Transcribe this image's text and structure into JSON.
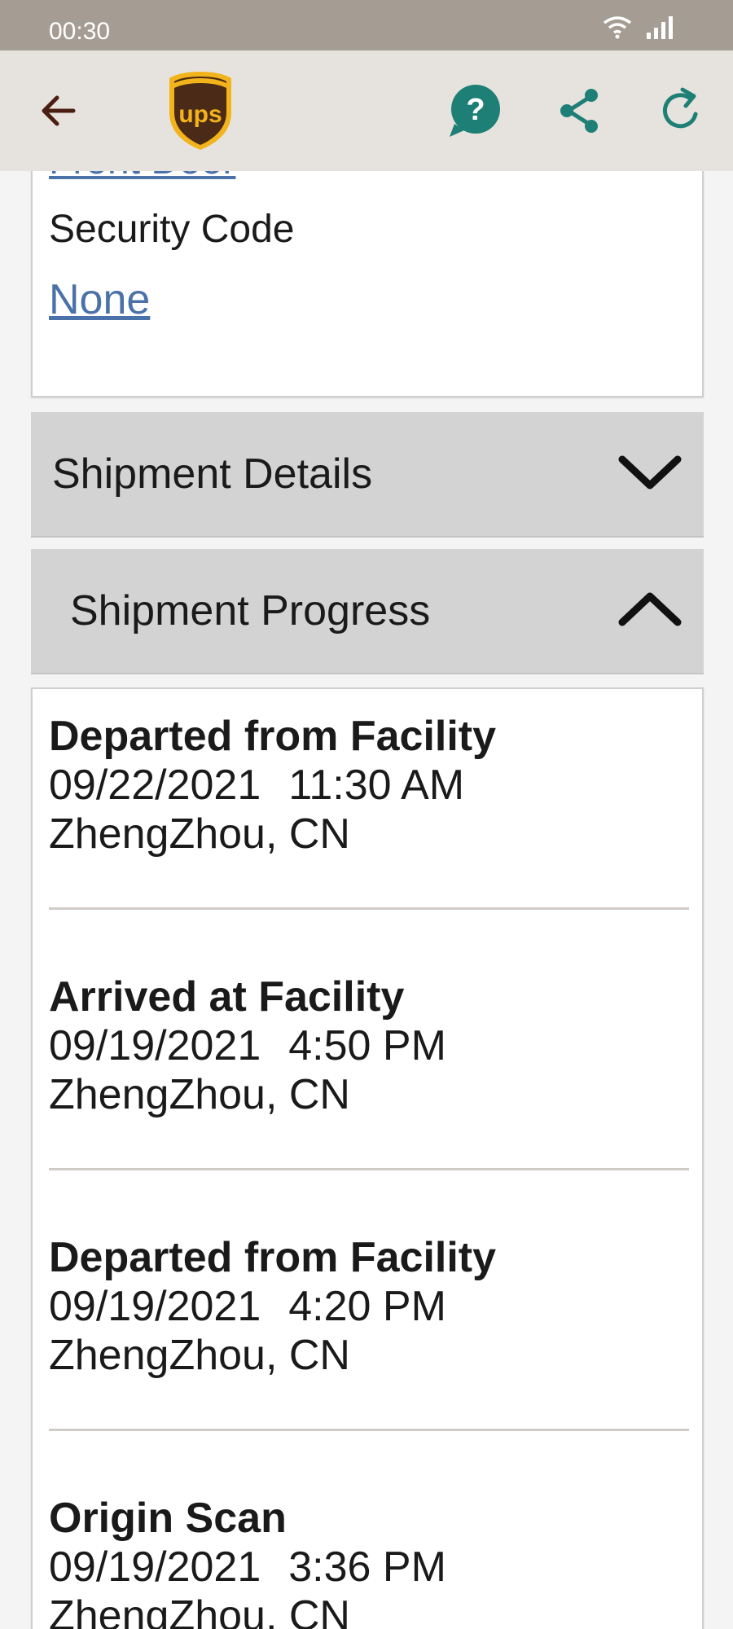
{
  "status_bar": {
    "time": "00:30",
    "icons": [
      "wifi-icon",
      "signal-icon"
    ]
  },
  "app_bar": {
    "icons": [
      "arrow-left-icon",
      "ups-logo",
      "help-chat-icon",
      "share-icon",
      "refresh-icon"
    ],
    "colors": {
      "background": "#e6e3de",
      "back": "#4a1f12",
      "accent": "#1d7f76"
    }
  },
  "delivery_card": {
    "cut_link": "Front Door",
    "security_label": "Security Code",
    "security_value": "None"
  },
  "sections": {
    "details": {
      "title": "Shipment Details",
      "state": "collapsed"
    },
    "progress": {
      "title": "Shipment Progress",
      "state": "expanded"
    }
  },
  "progress": [
    {
      "status": "Departed from Facility",
      "date": "09/22/2021",
      "time": "11:30 AM",
      "location": "ZhengZhou, CN"
    },
    {
      "status": "Arrived at Facility",
      "date": "09/19/2021",
      "time": "4:50 PM",
      "location": "ZhengZhou, CN"
    },
    {
      "status": "Departed from Facility",
      "date": "09/19/2021",
      "time": "4:20 PM",
      "location": "ZhengZhou, CN"
    },
    {
      "status": "Origin Scan",
      "date": "09/19/2021",
      "time": "3:36 PM",
      "location": "ZhengZhou, CN"
    }
  ]
}
